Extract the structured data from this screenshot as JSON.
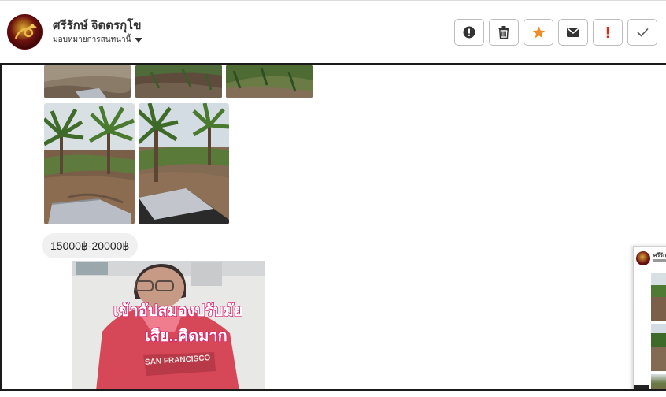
{
  "contact": {
    "name": "ศรีรักษ์ จิตตรกุโข",
    "assignment": "มอบหมายการสนทนานี้"
  },
  "toolbar": {
    "buttons": [
      {
        "icon": "alert-circle-icon",
        "color": "#333333"
      },
      {
        "icon": "trash-icon",
        "color": "#333333"
      },
      {
        "icon": "star-icon",
        "color": "#f28c28"
      },
      {
        "icon": "envelope-icon",
        "color": "#333333"
      },
      {
        "icon": "exclamation-icon",
        "color": "#e0261a"
      },
      {
        "icon": "check-icon",
        "color": "#555555"
      }
    ]
  },
  "messages": {
    "price_text": "15000฿-20000฿",
    "video_caption_line1": "เข้าอัปสมองปรับมัย",
    "video_caption_line2": "เสีย..คิดมาก",
    "video_shirt_text": "SAN FRANCISCO"
  },
  "thumbnail_preview": {
    "name_fragment": "ศรีรัก"
  }
}
